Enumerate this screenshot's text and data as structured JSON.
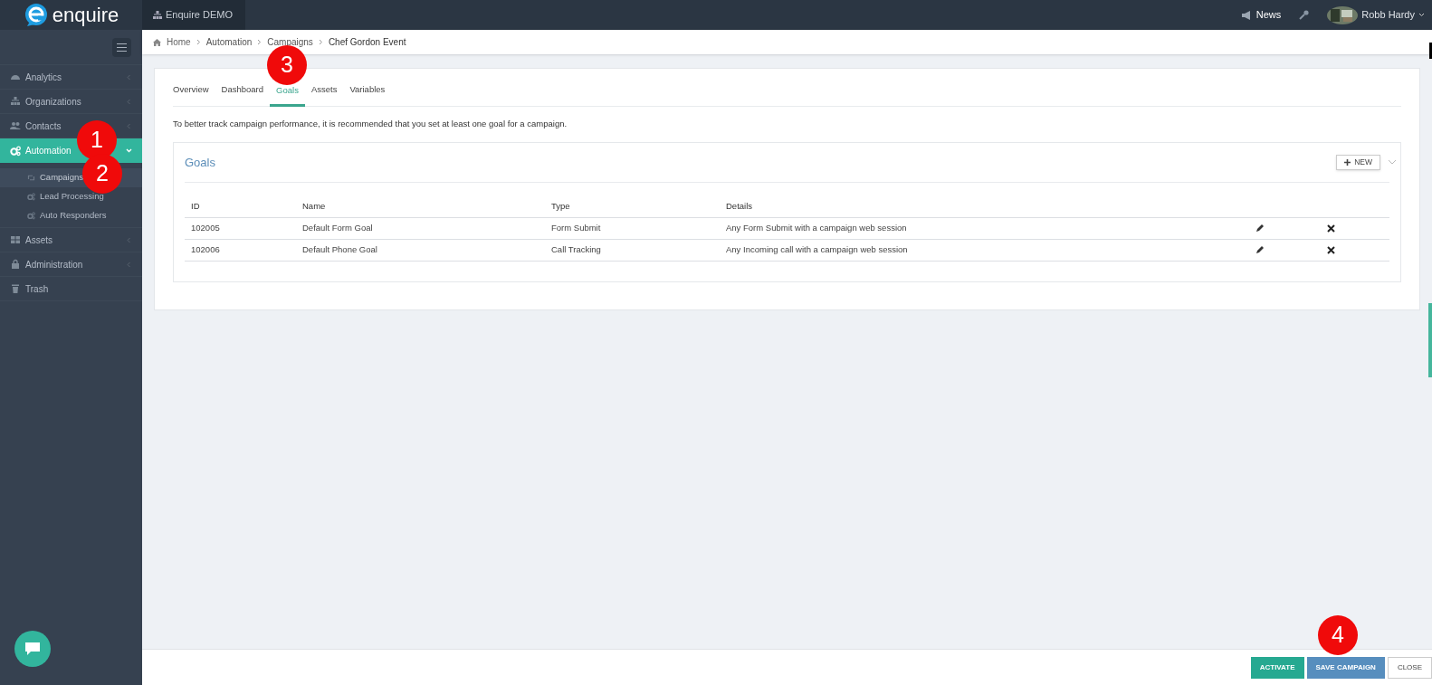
{
  "brand": {
    "name": "enquire"
  },
  "top_bar": {
    "account": "Enquire DEMO",
    "news": "News",
    "user": "Robb Hardy"
  },
  "sidebar": {
    "items": [
      {
        "label": "Analytics",
        "selected": false,
        "expanded": false
      },
      {
        "label": "Organizations",
        "selected": false,
        "expanded": false
      },
      {
        "label": "Contacts",
        "selected": false,
        "expanded": false
      },
      {
        "label": "Automation",
        "selected": true,
        "expanded": true,
        "children": [
          {
            "label": "Campaigns",
            "selected": true
          },
          {
            "label": "Lead Processing",
            "selected": false
          },
          {
            "label": "Auto Responders",
            "selected": false
          }
        ]
      },
      {
        "label": "Assets",
        "selected": false,
        "expanded": false
      },
      {
        "label": "Administration",
        "selected": false,
        "expanded": false
      },
      {
        "label": "Trash",
        "selected": false
      }
    ]
  },
  "breadcrumb": [
    {
      "label": "Home",
      "current": false
    },
    {
      "label": "Automation",
      "current": false
    },
    {
      "label": "Campaigns",
      "current": false
    },
    {
      "label": "Chef Gordon Event",
      "current": true
    }
  ],
  "tabs": [
    {
      "label": "Overview",
      "selected": false
    },
    {
      "label": "Dashboard",
      "selected": false
    },
    {
      "label": "Goals",
      "selected": true
    },
    {
      "label": "Assets",
      "selected": false
    },
    {
      "label": "Variables",
      "selected": false
    }
  ],
  "intro": "To better track campaign performance, it is recommended that you set at least one goal for a campaign.",
  "goals_panel": {
    "title": "Goals",
    "new_button": "NEW",
    "table": {
      "columns": [
        "ID",
        "Name",
        "Type",
        "Details"
      ],
      "rows": [
        {
          "cells": [
            "102005",
            "Default Form Goal",
            "Form Submit",
            "Any Form Submit with a campaign web session"
          ]
        },
        {
          "cells": [
            "102006",
            "Default Phone Goal",
            "Call Tracking",
            "Any Incoming call with a campaign web session"
          ]
        }
      ]
    }
  },
  "footer_buttons": [
    {
      "label": "ACTIVATE",
      "kind": "success"
    },
    {
      "label": "SAVE CAMPAIGN",
      "kind": "primary"
    },
    {
      "label": "CLOSE",
      "kind": "default"
    }
  ],
  "callouts": [
    "1",
    "2",
    "3",
    "4"
  ]
}
